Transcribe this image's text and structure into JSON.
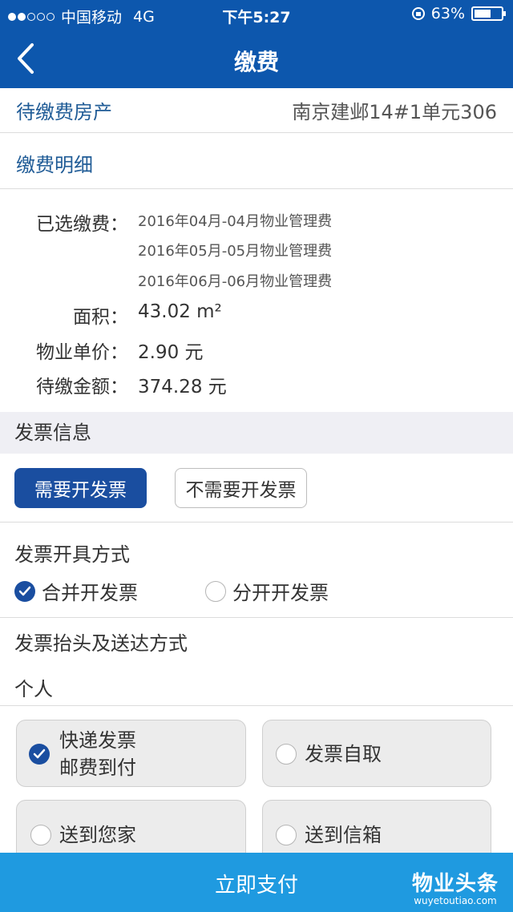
{
  "status_bar": {
    "carrier": "中国移动",
    "network": "4G",
    "time": "下午5:27",
    "battery": "63%",
    "battery_level": 0.63
  },
  "nav": {
    "title": "缴费",
    "back_icon": "chevron-left-icon"
  },
  "property": {
    "label": "待缴费房产",
    "value": "南京建邺14#1单元306"
  },
  "detail": {
    "header": "缴费明细",
    "selected_label": "已选缴费：",
    "fees": [
      "2016年04月-04月物业管理费",
      "2016年05月-05月物业管理费",
      "2016年06月-06月物业管理费"
    ],
    "area_label": "面积：",
    "area_value": "43.02 m²",
    "unit_price_label": "物业单价：",
    "unit_price_value": "2.90 元",
    "amount_label": "待缴金额：",
    "amount_value": "374.28 元"
  },
  "invoice": {
    "section_title": "发票信息",
    "need_button": "需要开发票",
    "no_need_button": "不需要开发票",
    "method_title": "发票开具方式",
    "merge_option": "合并开发票",
    "separate_option": "分开开发票",
    "title_delivery_label": "发票抬头及送达方式",
    "title_type": "个人",
    "options": {
      "express_line1": "快递发票",
      "express_line2": "邮费到付",
      "self_pickup": "发票自取",
      "to_home": "送到您家",
      "to_mailbox": "送到信箱"
    }
  },
  "footer": {
    "pay_button": "立即支付",
    "watermark_cn": "物业头条",
    "watermark_en": "wuyetoutiao.com"
  },
  "colors": {
    "primary": "#0d57ad",
    "button_blue": "#1a4ea0",
    "pay_bar": "#1f9ae0",
    "label_blue": "#1f5b96"
  }
}
